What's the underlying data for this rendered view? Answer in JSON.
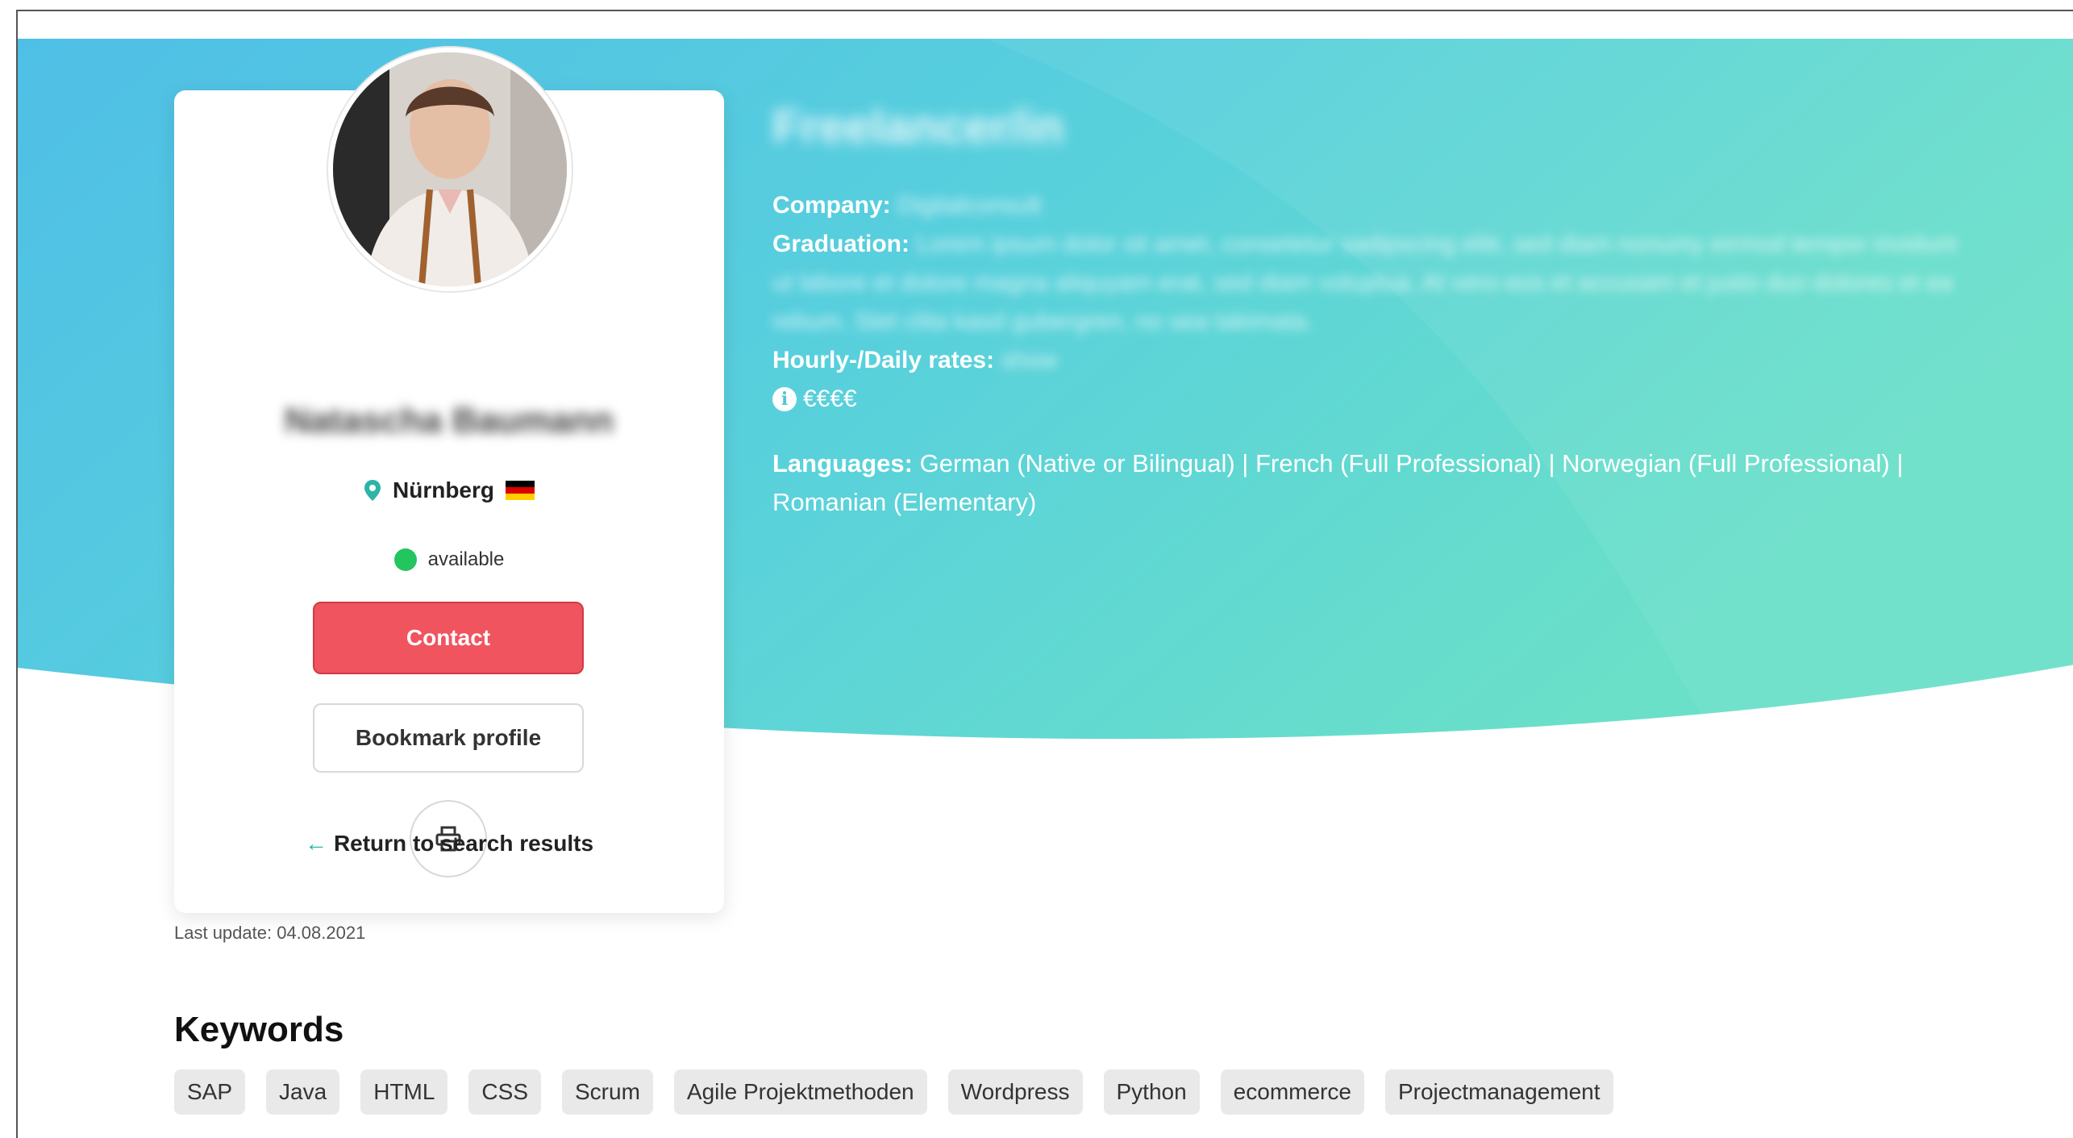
{
  "profile": {
    "name": "Natascha Baumann",
    "location": "Nürnberg",
    "country_flag": "de-flag-icon",
    "availability": "available",
    "contact_label": "Contact",
    "bookmark_label": "Bookmark profile",
    "return_label": "Return to search results",
    "last_update": "Last update: 04.08.2021"
  },
  "info": {
    "headline": "Freelancer/in",
    "company_label": "Company:",
    "company_value": "Digitalconsult",
    "graduation_label": "Graduation:",
    "graduation_value": "Lorem ipsum dolor sit amet, consetetur sadipscing elitr, sed diam nonumy eirmod tempor invidunt ut labore et dolore magna aliquyam erat, sed diam voluptua. At vero eos et accusam et justo duo dolores et ea rebum. Stet clita kasd gubergren, no sea takimata.",
    "rates_label": "Hourly-/Daily rates:",
    "rates_value": "show",
    "price_level": "€€€€",
    "languages_label": "Languages:",
    "languages_value": "German (Native or Bilingual) | French (Full Professional) | Norwegian (Full Professional) | Romanian (Elementary)"
  },
  "keywords": {
    "title": "Keywords",
    "tags": [
      "SAP",
      "Java",
      "HTML",
      "CSS",
      "Scrum",
      "Agile Projektmethoden",
      "Wordpress",
      "Python",
      "ecommerce",
      "Projectmanagement"
    ]
  },
  "colors": {
    "hero_start": "#4fbfe4",
    "hero_end": "#5fdcc9",
    "contact": "#f0545f",
    "available": "#22c55e",
    "accent": "#2bb5a6"
  }
}
